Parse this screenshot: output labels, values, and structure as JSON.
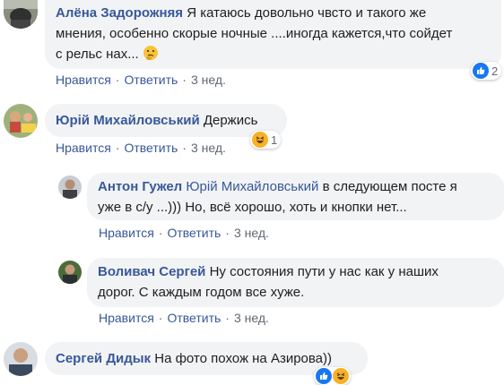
{
  "comments": [
    {
      "author": "Алёна Задорожняя",
      "text_line1": "Я катаюсь довольно чвсто и такого же",
      "text_line2": "мнения, особенно скорые ночные ....иногда кажется,что сойдет",
      "text_line3": "с рельс нах...",
      "emoji_icon": "thinking-face-icon",
      "like_label": "Нравится",
      "reply_label": "Ответить",
      "time": "3 нед.",
      "reaction_count": "2"
    },
    {
      "author": "Юрій Михайловський",
      "text": "Держись",
      "like_label": "Нравится",
      "reply_label": "Ответить",
      "time": "3 нед.",
      "reaction_count": "1"
    },
    {
      "author": "Антон Гужел",
      "mention": "Юрій Михайловський",
      "text_line1": "в следующем посте я",
      "text_line2": "уже в с/у ...))) Но, всё хорошо, хоть и кнопки нет...",
      "like_label": "Нравится",
      "reply_label": "Ответить",
      "time": "3 нед."
    },
    {
      "author": "Воливач Сергей",
      "text_line1": "Ну состояния пути у нас как у наших",
      "text_line2": "дорог. С каждым годом все хуже.",
      "like_label": "Нравится",
      "reply_label": "Ответить",
      "time": "3 нед."
    },
    {
      "author": "Сергей Дидык",
      "text": "На фото похож на Азирова))"
    }
  ],
  "separator": "·",
  "colors": {
    "link": "#385898",
    "bubble": "#f2f3f5",
    "meta": "#606770",
    "like": "#1877f2",
    "haha": "#f7b125"
  }
}
